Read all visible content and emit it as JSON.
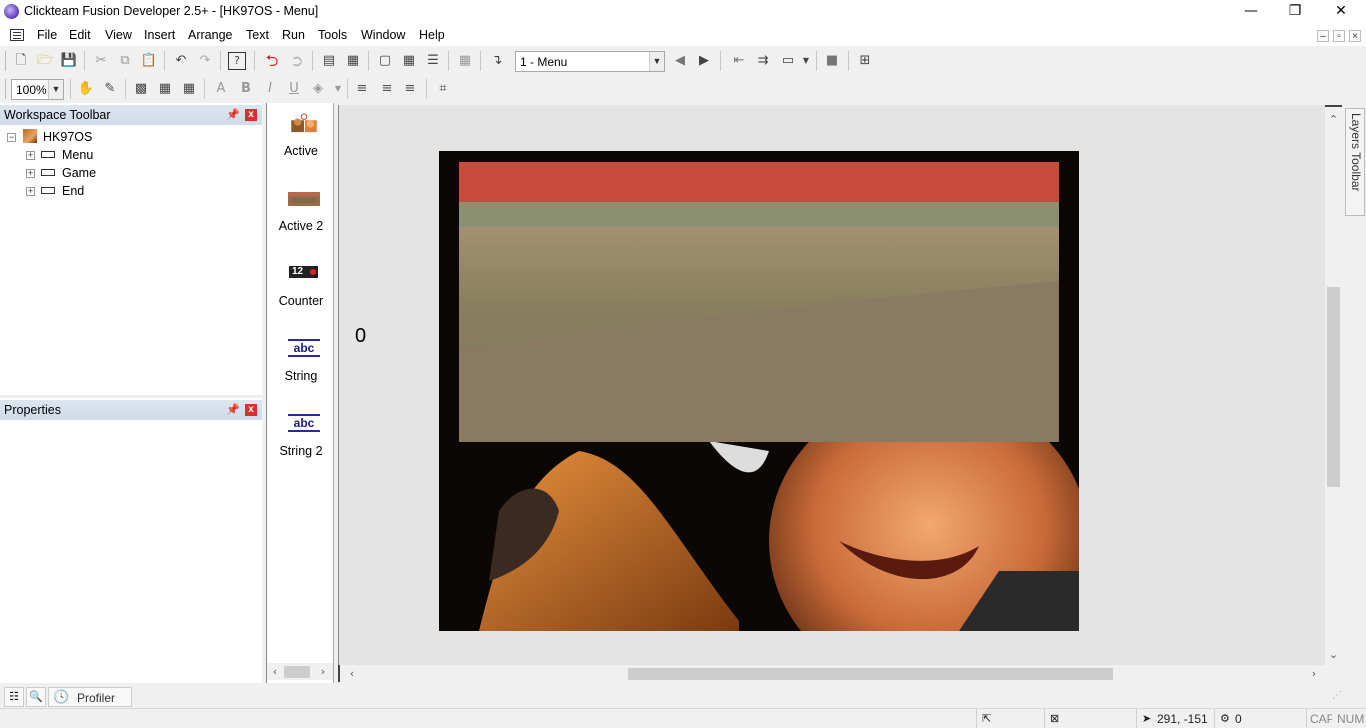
{
  "window": {
    "title": "Clickteam Fusion Developer 2.5+ - [HK97OS - Menu]",
    "controls": {
      "minimize": "—",
      "restore": "❐",
      "close": "✕"
    }
  },
  "menubar": {
    "items": [
      "File",
      "Edit",
      "View",
      "Insert",
      "Arrange",
      "Text",
      "Run",
      "Tools",
      "Window",
      "Help"
    ]
  },
  "toolbar": {
    "frame_select": "1 - Menu",
    "zoom": "100%"
  },
  "workspace": {
    "title": "Workspace Toolbar",
    "app_name": "HK97OS",
    "frames": [
      "Menu",
      "Game",
      "End"
    ]
  },
  "properties": {
    "title": "Properties"
  },
  "palette": {
    "items": [
      "Active",
      "Active 2",
      "Counter",
      "String",
      "String 2"
    ],
    "counter_icon_text": "12",
    "string_icon_text": "abc"
  },
  "editor": {
    "counter_value": "0"
  },
  "layers_tab": "Layers Toolbar",
  "bottom_tabs": {
    "profiler": "Profiler"
  },
  "status": {
    "coords": "291, -151",
    "objects": "0",
    "cap": "CAP",
    "num": "NUM"
  }
}
